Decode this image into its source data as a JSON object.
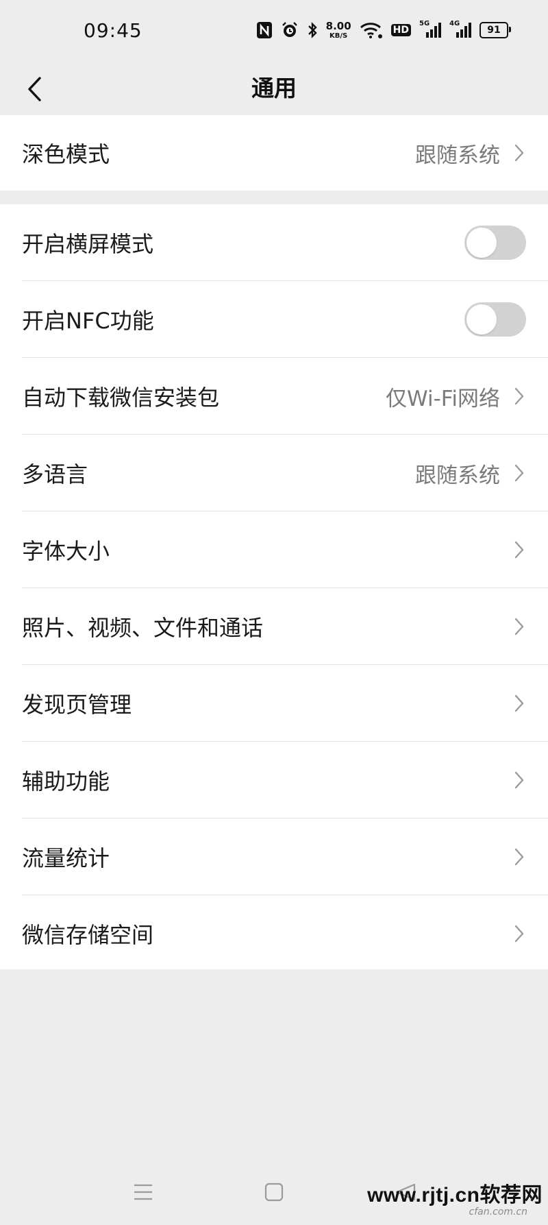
{
  "status_bar": {
    "time": "09:45",
    "net_speed_value": "8.00",
    "net_speed_unit": "KB/S",
    "hd_label": "HD",
    "signal1_gen": "5G",
    "signal2_gen": "4G",
    "battery": "91",
    "icons": [
      "nfc-icon",
      "alarm-icon",
      "bluetooth-icon",
      "wifi-icon",
      "hd-icon",
      "signal-icon",
      "signal-icon",
      "battery-icon"
    ]
  },
  "header": {
    "title": "通用",
    "back_icon": "chevron-left-icon"
  },
  "settings": {
    "dark_mode": {
      "label": "深色模式",
      "value": "跟随系统"
    },
    "landscape": {
      "label": "开启横屏模式",
      "enabled": false
    },
    "nfc": {
      "label": "开启NFC功能",
      "enabled": false
    },
    "auto_download": {
      "label": "自动下载微信安装包",
      "value": "仅Wi-Fi网络"
    },
    "language": {
      "label": "多语言",
      "value": "跟随系统"
    },
    "font_size": {
      "label": "字体大小"
    },
    "media": {
      "label": "照片、视频、文件和通话"
    },
    "discover": {
      "label": "发现页管理"
    },
    "accessibility": {
      "label": "辅助功能"
    },
    "data_usage": {
      "label": "流量统计"
    },
    "storage": {
      "label": "微信存储空间"
    }
  },
  "watermark": {
    "text": "www.rjtj.cn软荐网",
    "small": "cfan.com.cn"
  },
  "colors": {
    "background": "#ededed",
    "card": "#ffffff",
    "secondary_text": "#7a7a7a",
    "toggle_off": "#d2d2d2"
  }
}
